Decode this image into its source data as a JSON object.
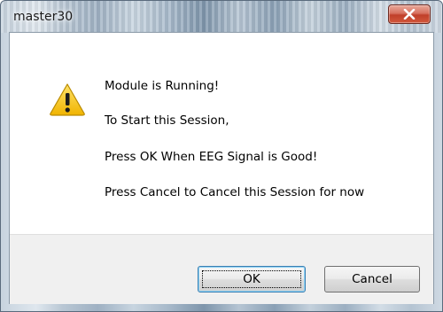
{
  "window": {
    "title": "master30"
  },
  "dialog": {
    "icon": "warning-icon",
    "lines": [
      "Module is Running!",
      "To Start this Session,",
      "Press OK When EEG Signal is Good!",
      "Press Cancel to Cancel this Session for now"
    ]
  },
  "buttons": {
    "ok_label": "OK",
    "cancel_label": "Cancel"
  },
  "colors": {
    "close_button": "#c0402a",
    "warning_yellow": "#f5c400",
    "button_bar": "#f0f0f0"
  }
}
